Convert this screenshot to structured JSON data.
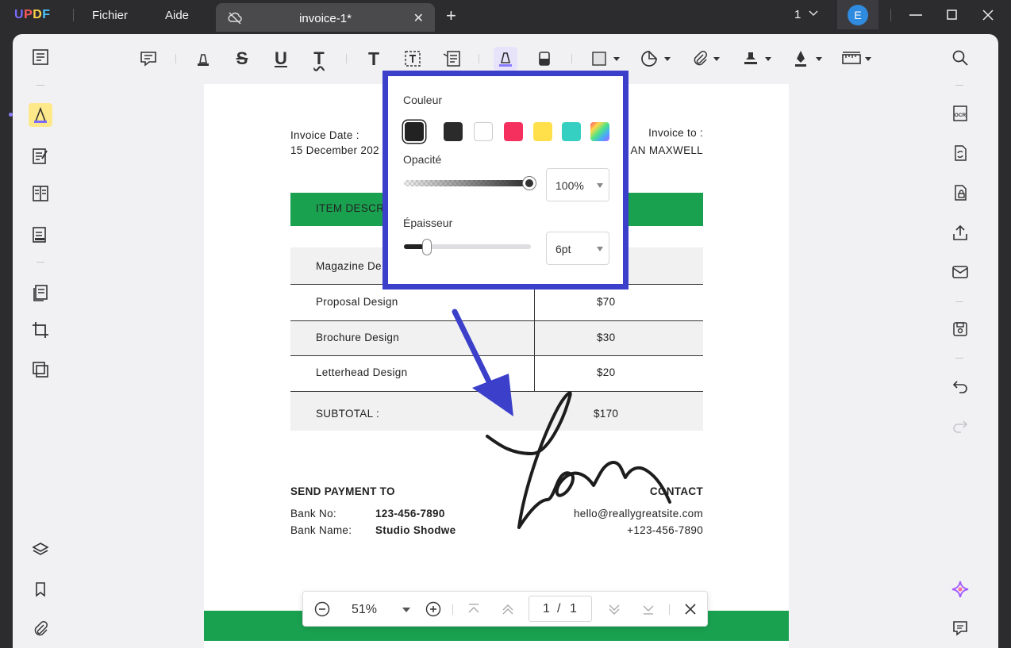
{
  "app": {
    "logo": "UPDF"
  },
  "menu": {
    "file": "Fichier",
    "help": "Aide"
  },
  "tab": {
    "title": "invoice-1*"
  },
  "titlebar": {
    "page_count": "1",
    "avatar_letter": "E"
  },
  "colors": {
    "accent": "#3b3fc9",
    "green": "#1aa150",
    "highlight_active": "#fde98a"
  },
  "invoice": {
    "date_label": "Invoice Date :",
    "date_value": "15 December 202",
    "to_label": "Invoice to :",
    "to_value": "AN MAXWELL",
    "item_header": "ITEM DESCR",
    "rows": [
      {
        "item": "Magazine De",
        "price": ""
      },
      {
        "item": "Proposal Design",
        "price": "$70"
      },
      {
        "item": "Brochure Design",
        "price": "$30"
      },
      {
        "item": "Letterhead Design",
        "price": "$20"
      }
    ],
    "subtotal_label": "SUBTOTAL :",
    "subtotal_value": "$170",
    "payment_title": "SEND PAYMENT TO",
    "bank_no_label": "Bank No:",
    "bank_no_value": "123-456-7890",
    "bank_name_label": "Bank Name:",
    "bank_name_value": "Studio Shodwe",
    "contact_title": "CONTACT",
    "contact_email": "hello@reallygreatsite.com",
    "contact_phone": "+123-456-7890"
  },
  "popup": {
    "color_label": "Couleur",
    "swatches": [
      "#222222",
      "#2b2b2b",
      "#ffffff",
      "#f5305e",
      "#ffe04a",
      "#35d0c2",
      "rainbow"
    ],
    "selected_swatch": 0,
    "opacity_label": "Opacité",
    "opacity_value": "100%",
    "opacity_level": 1.0,
    "thickness_label": "Épaisseur",
    "thickness_value": "6pt",
    "thickness_level": 0.18
  },
  "zoom": {
    "value": "51%",
    "current_page": "1",
    "separator": "/",
    "total_pages": "1"
  }
}
